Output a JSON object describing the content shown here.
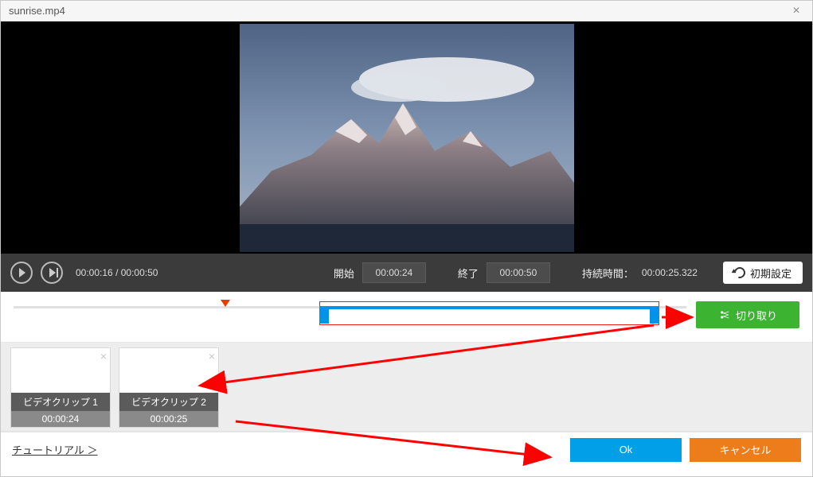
{
  "window": {
    "title": "sunrise.mp4"
  },
  "playback": {
    "current": "00:00:16",
    "total": "00:00:50"
  },
  "trim": {
    "start_label": "開始",
    "start_value": "00:00:24",
    "end_label": "終了",
    "end_value": "00:00:50",
    "duration_label": "持続時間：",
    "duration_value": "00:00:25.322"
  },
  "reset": {
    "label": "初期設定"
  },
  "cut": {
    "label": "切り取り"
  },
  "clips": [
    {
      "name": "ビデオクリップ 1",
      "time": "00:00:24"
    },
    {
      "name": "ビデオクリップ 2",
      "time": "00:00:25"
    }
  ],
  "footer": {
    "tutorial": "チュートリアル ＞",
    "ok": "Ok",
    "cancel": "キャンセル"
  },
  "timeline": {
    "playhead_pct": 32,
    "range_start_pct": 47,
    "range_end_pct": 97
  }
}
